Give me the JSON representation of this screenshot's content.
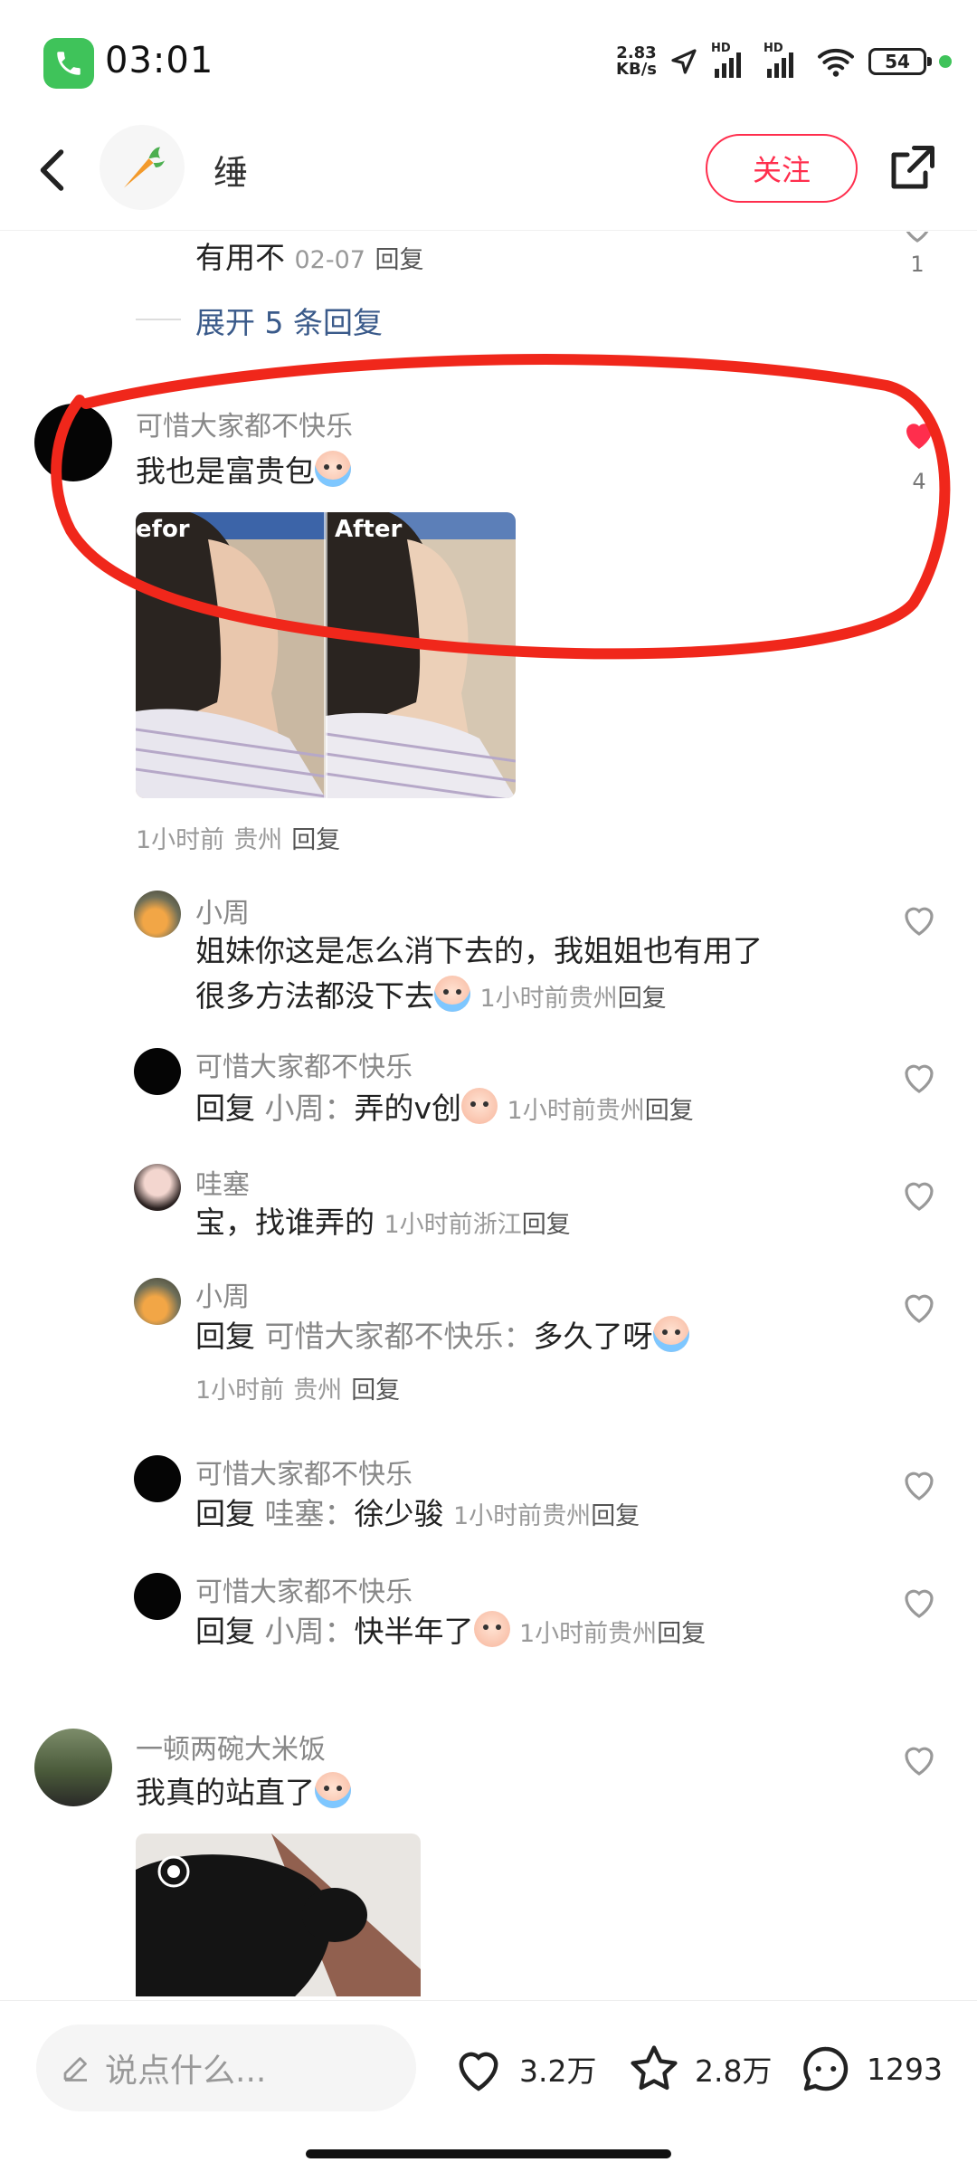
{
  "status_bar": {
    "time": "03:01",
    "speed_value": "2.83",
    "speed_unit": "KB/s",
    "hd1": "HD",
    "hd2": "HD",
    "battery": "54",
    "call_icon": "phone-icon",
    "accent": "#3fc35a"
  },
  "header": {
    "author_name": "缍",
    "follow_label": "关注",
    "follow_color": "#ff2e4d",
    "avatar_icon": "carrot-icon"
  },
  "top_reply": {
    "text": "有用不",
    "date": "02-07",
    "reply_label": "回复",
    "likes": "1"
  },
  "expand": {
    "label": "展开 5 条回复"
  },
  "main_comment": {
    "name": "可惜大家都不快乐",
    "text": "我也是富贵包",
    "likes": "4",
    "photo_label_before": "efor",
    "photo_label_after": "After",
    "time": "1小时前",
    "location": "贵州",
    "reply_label": "回复",
    "heart_color": "#ff2e4d"
  },
  "replies": [
    {
      "name": "小周",
      "line1": "姐妹你这是怎么消下去的，我姐姐也有用了",
      "line2": "很多方法都没下去",
      "time": "1小时前",
      "location": "贵州",
      "reply_label": "回复"
    },
    {
      "name": "可惜大家都不快乐",
      "prefix": "回复",
      "target": "小周：",
      "content": "弄的v创",
      "time": "1小时前",
      "location": "贵州",
      "reply_label": "回复"
    },
    {
      "name": "哇塞",
      "content": "宝，找谁弄的",
      "time": "1小时前",
      "location": "浙江",
      "reply_label": "回复"
    },
    {
      "name": "小周",
      "prefix": "回复",
      "target": "可惜大家都不快乐：",
      "content": "多久了呀",
      "time": "1小时前",
      "location": "贵州",
      "reply_label": "回复"
    },
    {
      "name": "可惜大家都不快乐",
      "prefix": "回复",
      "target": "哇塞：",
      "content": "徐少骏",
      "time": "1小时前",
      "location": "贵州",
      "reply_label": "回复"
    },
    {
      "name": "可惜大家都不快乐",
      "prefix": "回复",
      "target": "小周：",
      "content": "快半年了",
      "time": "1小时前",
      "location": "贵州",
      "reply_label": "回复"
    }
  ],
  "next_comment": {
    "name": "一顿两碗大米饭",
    "text": "我真的站直了"
  },
  "bottom_bar": {
    "input_placeholder": "说点什么...",
    "likes": "3.2万",
    "stars": "2.8万",
    "comments": "1293"
  }
}
